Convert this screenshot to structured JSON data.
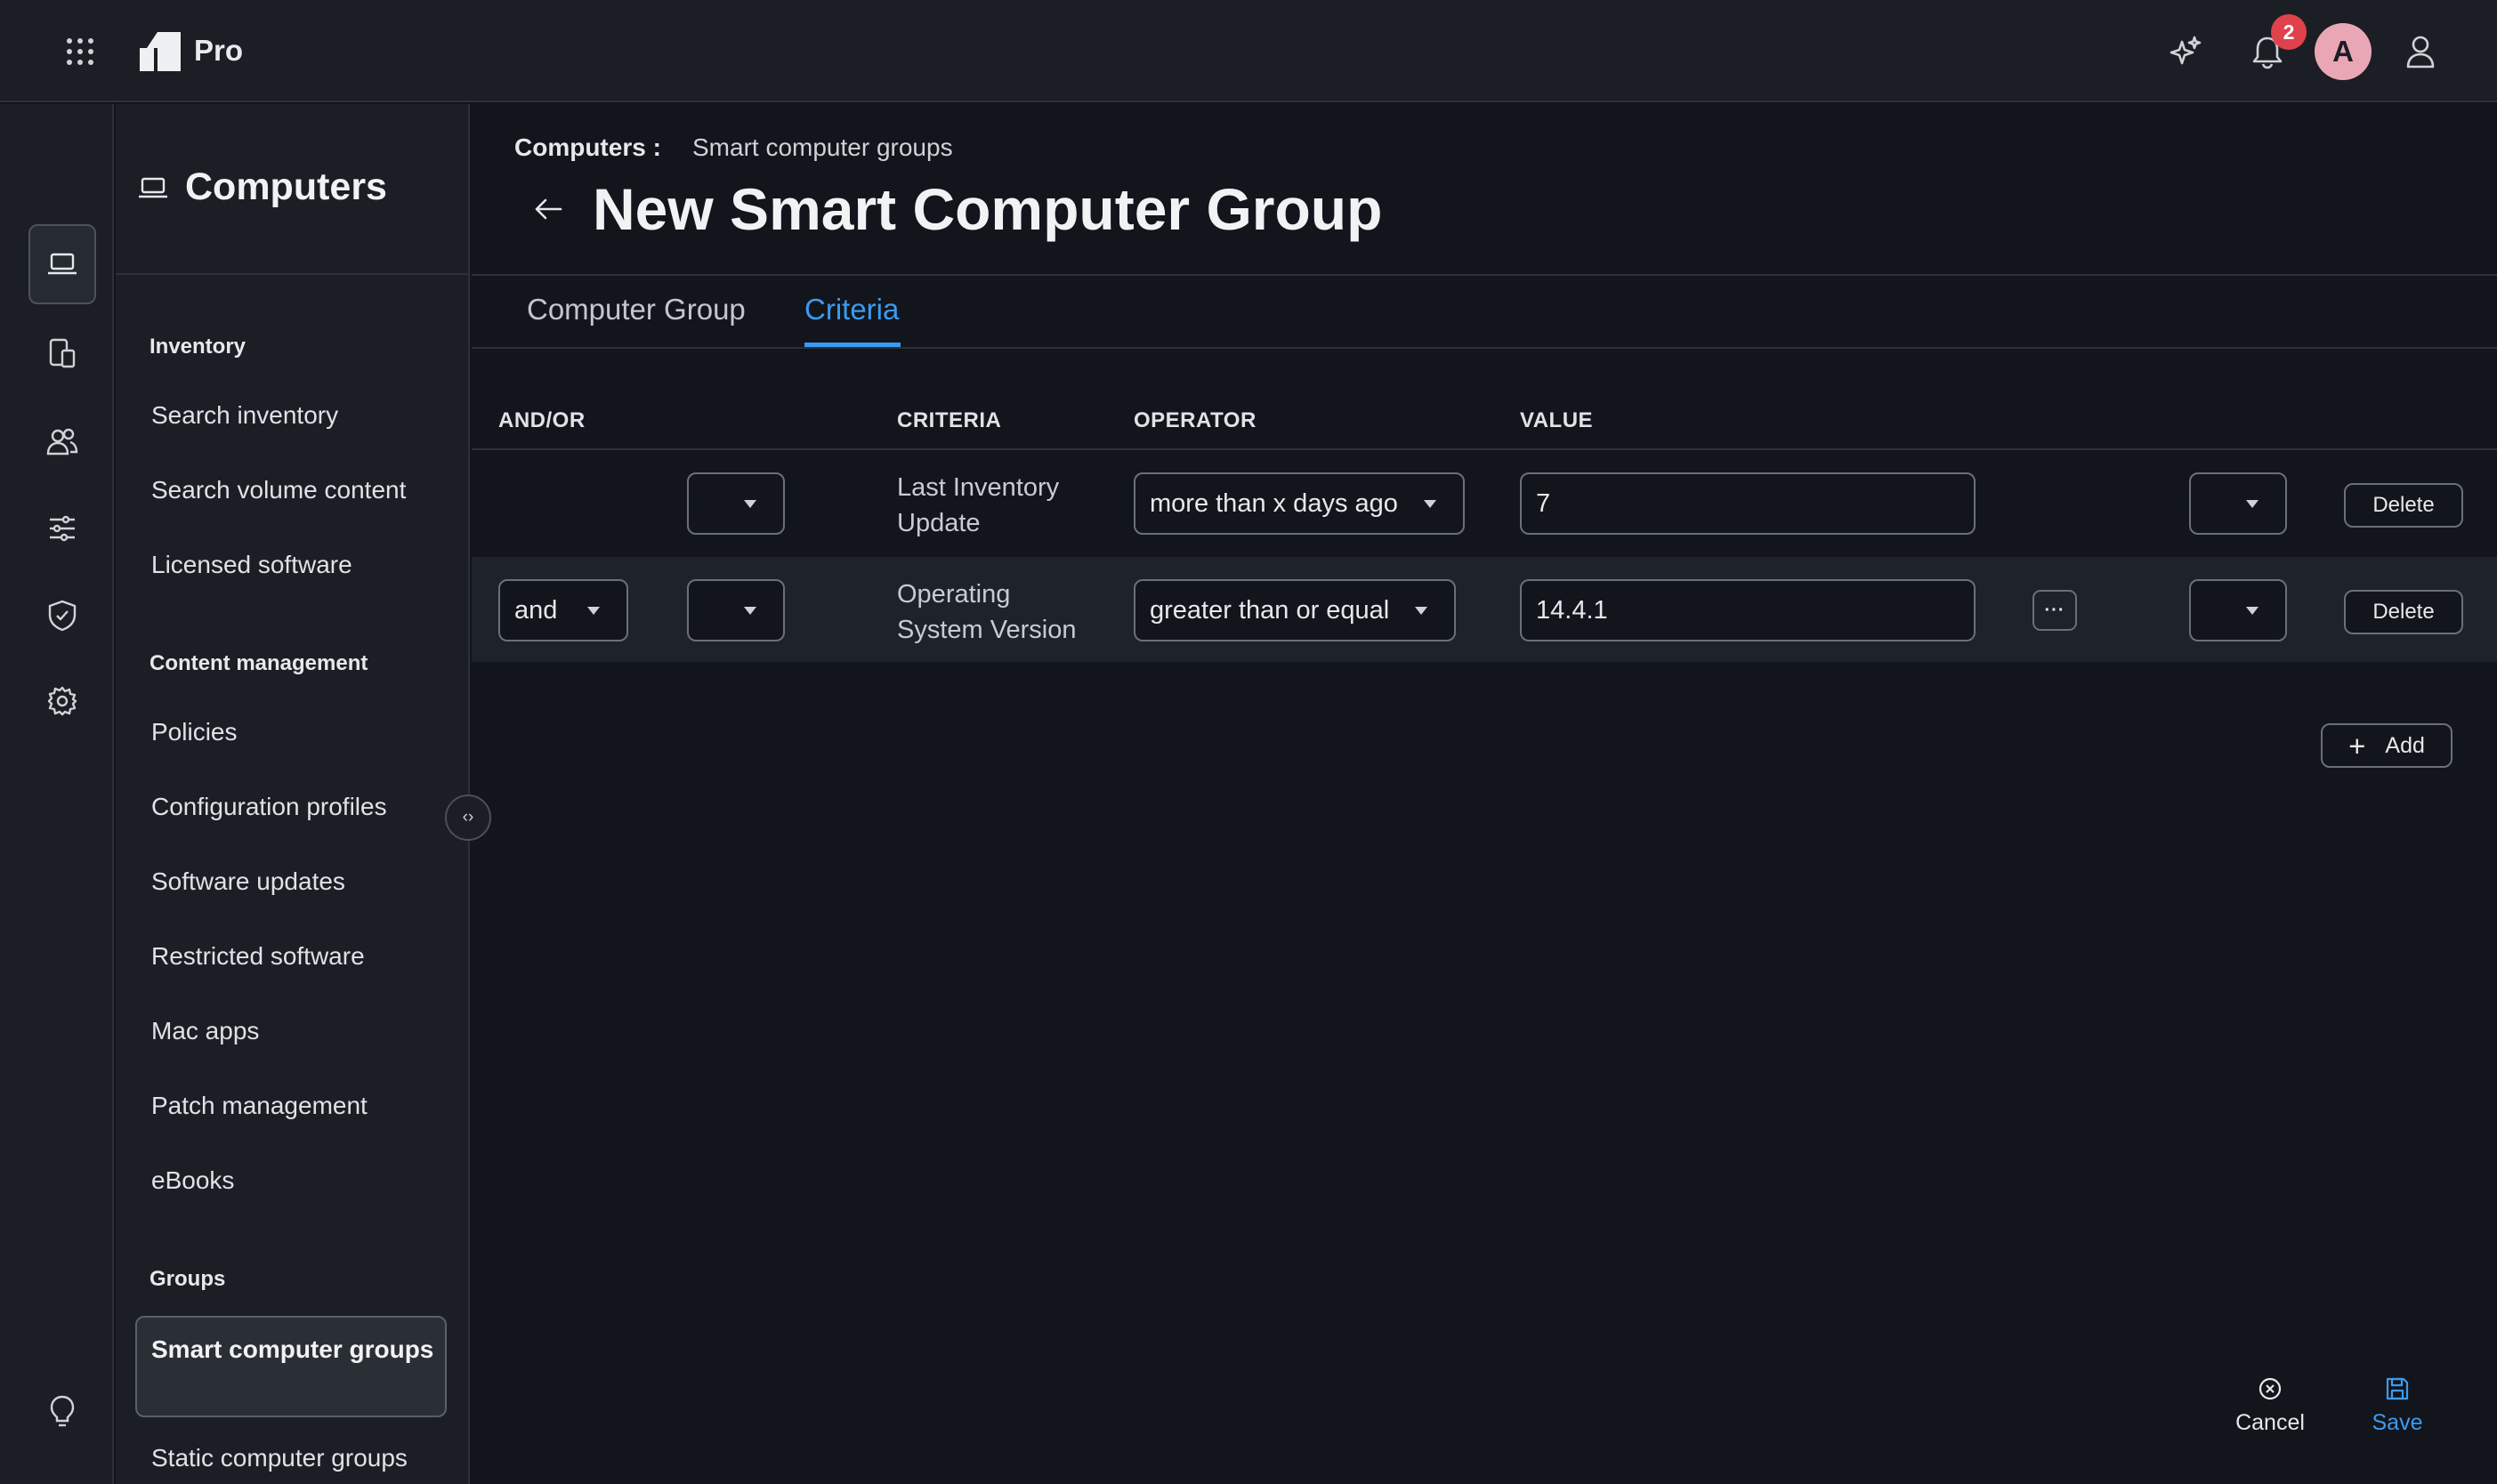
{
  "app": {
    "brand": "Pro",
    "notifications_count": "2",
    "avatar_initial": "A"
  },
  "sidenav": {
    "title": "Computers",
    "sections": {
      "inventory": "Inventory",
      "content": "Content management",
      "groups": "Groups"
    },
    "items": {
      "search_inventory": "Search inventory",
      "search_volume": "Search volume content",
      "licensed": "Licensed software",
      "policies": "Policies",
      "config_profiles": "Configuration profiles",
      "software_updates": "Software updates",
      "restricted": "Restricted software",
      "mac_apps": "Mac apps",
      "patch": "Patch management",
      "ebooks": "eBooks",
      "smart_groups": "Smart computer groups",
      "static_groups": "Static computer groups"
    }
  },
  "breadcrumb": {
    "parent": "Computers :",
    "current": "Smart computer groups"
  },
  "page": {
    "title": "New Smart Computer Group"
  },
  "tabs": {
    "group": "Computer Group",
    "criteria": "Criteria"
  },
  "table": {
    "headers": {
      "and_or": "AND/OR",
      "criteria": "CRITERIA",
      "operator": "OPERATOR",
      "value": "VALUE"
    },
    "rows": [
      {
        "and_or": "",
        "criteria_line1": "Last Inventory",
        "criteria_line2": "Update",
        "operator": "more than x days ago",
        "value": "7",
        "delete": "Delete"
      },
      {
        "and_or": "and",
        "criteria_line1": "Operating",
        "criteria_line2": "System Version",
        "operator": "greater than or equal",
        "value": "14.4.1",
        "more": "···",
        "delete": "Delete"
      }
    ]
  },
  "actions": {
    "add": "Add",
    "cancel": "Cancel",
    "save": "Save"
  },
  "colors": {
    "accent": "#3b9bf2",
    "badge": "#e0424b",
    "avatar": "#e9a7b6"
  }
}
